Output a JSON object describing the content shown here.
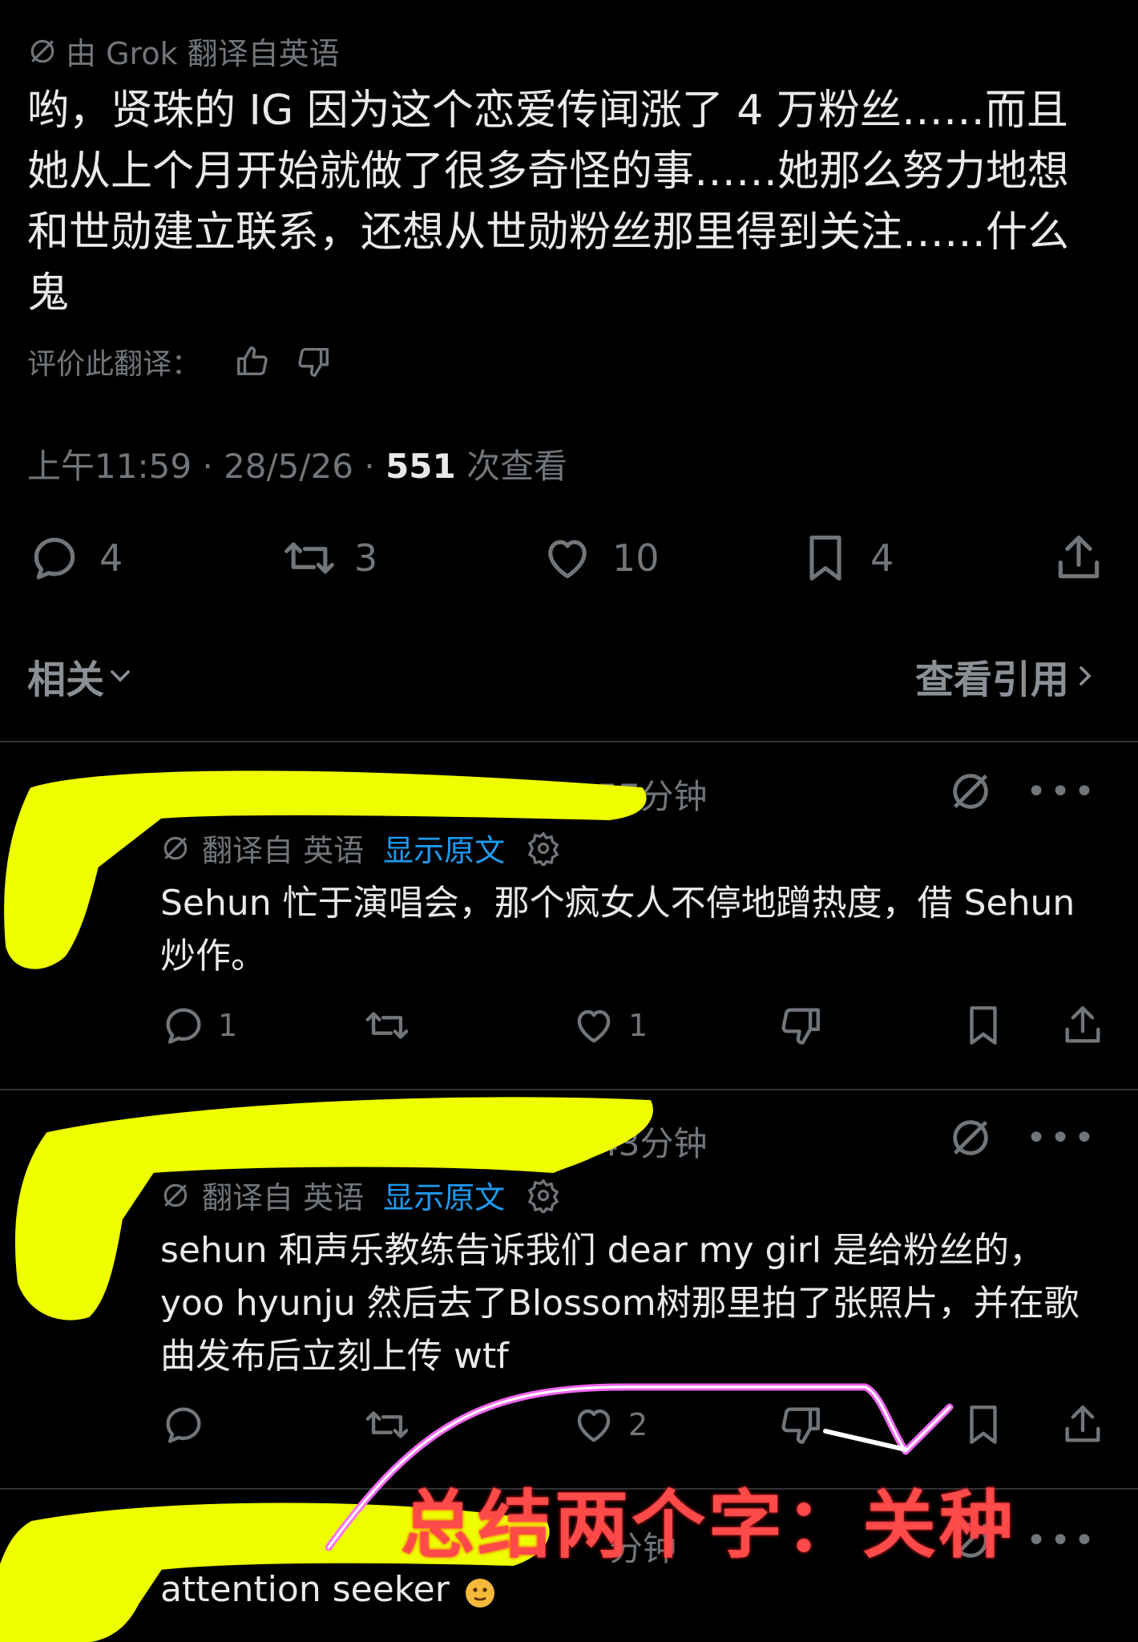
{
  "tweet": {
    "translation_label": "由 Grok 翻译自英语",
    "text": "哟，贤珠的 IG 因为这个恋爱传闻涨了 4 万粉丝……而且她从上个月开始就做了很多奇怪的事……她那么努力地想和世勋建立联系，还想从世勋粉丝那里得到关注……什么鬼",
    "rate_label": "评价此翻译：",
    "time": "上午11:59 · 28/5/26 · ",
    "views_count": "551",
    "views_label": " 次查看",
    "actions": {
      "replies": "4",
      "reposts": "3",
      "likes": "10",
      "bookmarks": "4"
    }
  },
  "related": {
    "label": "相关",
    "view_quotes": "查看引用"
  },
  "replies": [
    {
      "time": "57分钟",
      "translation_label": "翻译自 英语",
      "show_original": "显示原文",
      "text": "Sehun 忙于演唱会，那个疯女人不停地蹭热度，借 Sehun 炒作。",
      "replies": "1",
      "likes": "1"
    },
    {
      "time": "43分钟",
      "translation_label": "翻译自 英语",
      "show_original": "显示原文",
      "text": "sehun 和声乐教练告诉我们 dear my girl 是给粉丝的，yoo hyunju 然后去了Blossom树那里拍了张照片，并在歌曲发布后立刻上传 wtf",
      "likes": "2"
    },
    {
      "time": "分钟",
      "text": "attention seeker"
    }
  ],
  "overlay": {
    "caption": "总结两个字：关种"
  },
  "colors": {
    "background": "#000000",
    "text": "#e7e9ea",
    "muted": "#71767b",
    "link": "#1d9bf0",
    "highlighter": "#eeff00",
    "annotation": "#ff4a4a"
  }
}
